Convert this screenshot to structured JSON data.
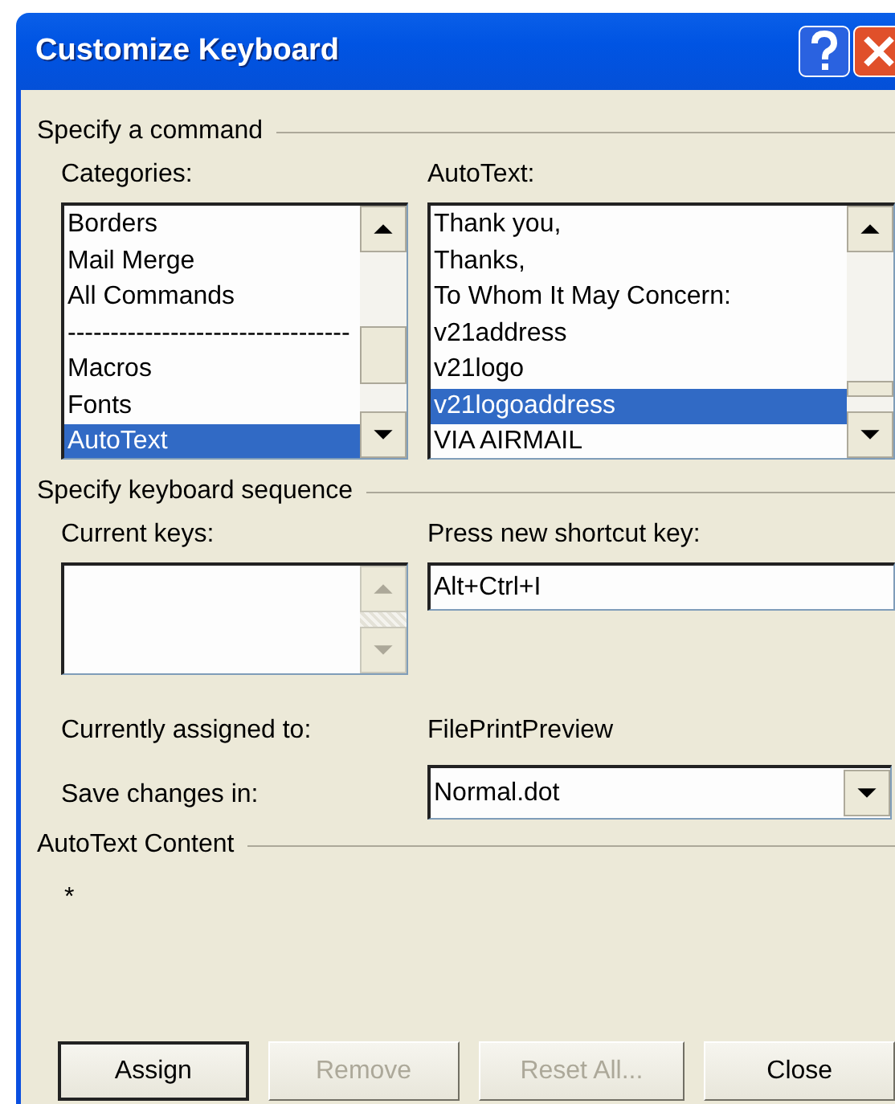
{
  "window": {
    "title": "Customize Keyboard"
  },
  "command_section": {
    "title": "Specify a command",
    "categories": {
      "label": "Categories:",
      "items": [
        {
          "text": "Borders",
          "selected": false
        },
        {
          "text": "Mail Merge",
          "selected": false
        },
        {
          "text": "All Commands",
          "selected": false
        },
        {
          "text": "---------------------------------",
          "selected": false
        },
        {
          "text": "Macros",
          "selected": false
        },
        {
          "text": "Fonts",
          "selected": false
        },
        {
          "text": "AutoText",
          "selected": true
        }
      ]
    },
    "autotext": {
      "label": "AutoText:",
      "items": [
        {
          "text": "Thank you,",
          "selected": false
        },
        {
          "text": "Thanks,",
          "selected": false
        },
        {
          "text": "To Whom It May Concern:",
          "selected": false
        },
        {
          "text": "v21address",
          "selected": false
        },
        {
          "text": "v21logo",
          "selected": false
        },
        {
          "text": "v21logoaddress",
          "selected": true
        },
        {
          "text": "VIA AIRMAIL",
          "selected": false
        }
      ]
    }
  },
  "keyboard_section": {
    "title": "Specify keyboard sequence",
    "current_keys": {
      "label": "Current keys:"
    },
    "new_shortcut": {
      "label": "Press new shortcut key:",
      "value": "Alt+Ctrl+I"
    },
    "assigned_label": "Currently assigned to:",
    "assigned_value": "FilePrintPreview",
    "save_label": "Save changes in:",
    "save_value": "Normal.dot"
  },
  "content_section": {
    "title": "AutoText Content",
    "content": "*"
  },
  "buttons": [
    {
      "label": "Assign",
      "disabled": false,
      "default": true
    },
    {
      "label": "Remove",
      "disabled": true,
      "default": false
    },
    {
      "label": "Reset All...",
      "disabled": true,
      "default": false
    },
    {
      "label": "Close",
      "disabled": false,
      "default": false
    }
  ]
}
